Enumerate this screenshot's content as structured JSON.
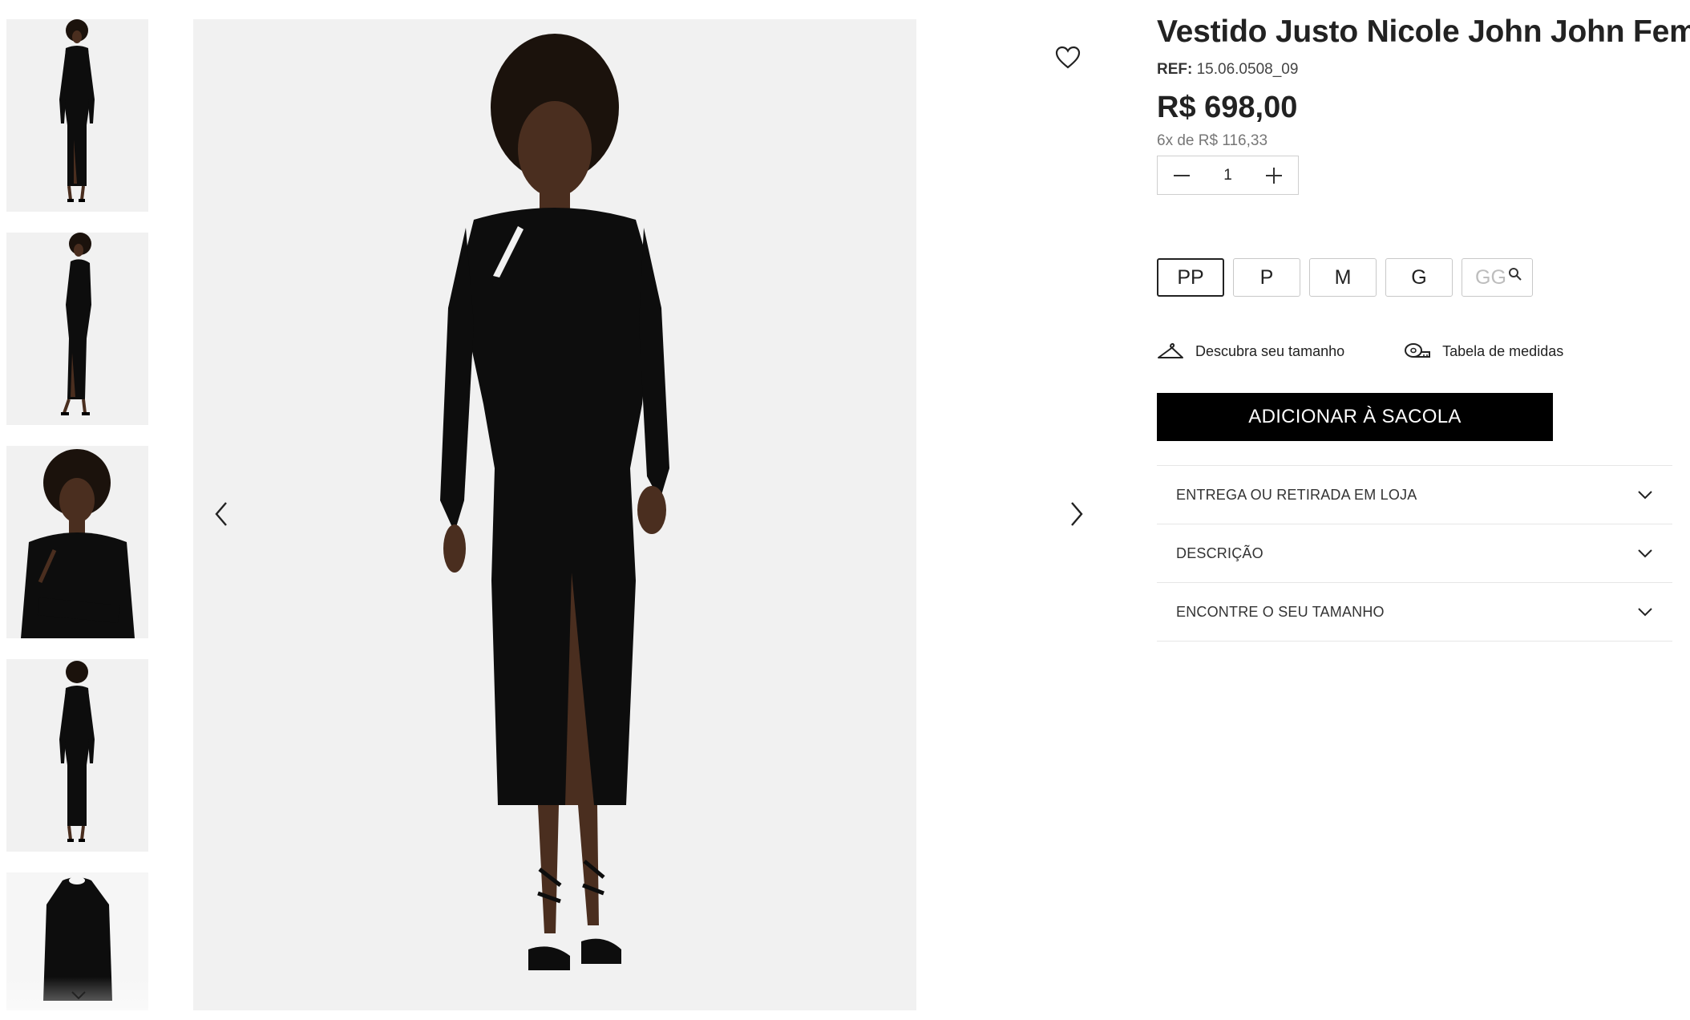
{
  "product": {
    "title": "Vestido Justo Nicole John John Feminino",
    "ref_label": "REF:",
    "ref_value": "15.06.0508_09",
    "price": "R$ 698,00",
    "installments": "6x de R$ 116,33"
  },
  "quantity": {
    "value": "1"
  },
  "sizes": [
    {
      "label": "PP",
      "state": "selected"
    },
    {
      "label": "P",
      "state": "available"
    },
    {
      "label": "M",
      "state": "available"
    },
    {
      "label": "G",
      "state": "available"
    },
    {
      "label": "GG",
      "state": "unavailable"
    }
  ],
  "helpers": {
    "find_size": "Descubra seu tamanho",
    "size_chart": "Tabela de medidas"
  },
  "cta": {
    "add_to_bag": "ADICIONAR À SACOLA"
  },
  "accordion": [
    {
      "label": "ENTREGA OU RETIRADA EM LOJA"
    },
    {
      "label": "DESCRIÇÃO"
    },
    {
      "label": "ENCONTRE O SEU TAMANHO"
    }
  ],
  "icons": {
    "favorite": "heart-icon",
    "prev": "chevron-left-icon",
    "next": "chevron-right-icon",
    "minus": "minus-icon",
    "plus": "plus-icon",
    "notify": "search-icon",
    "hanger": "hanger-icon",
    "tape": "measuring-tape-icon",
    "expand": "chevron-down-icon"
  },
  "colors": {
    "button": "#000000",
    "image_bg": "#f1f1f1"
  }
}
